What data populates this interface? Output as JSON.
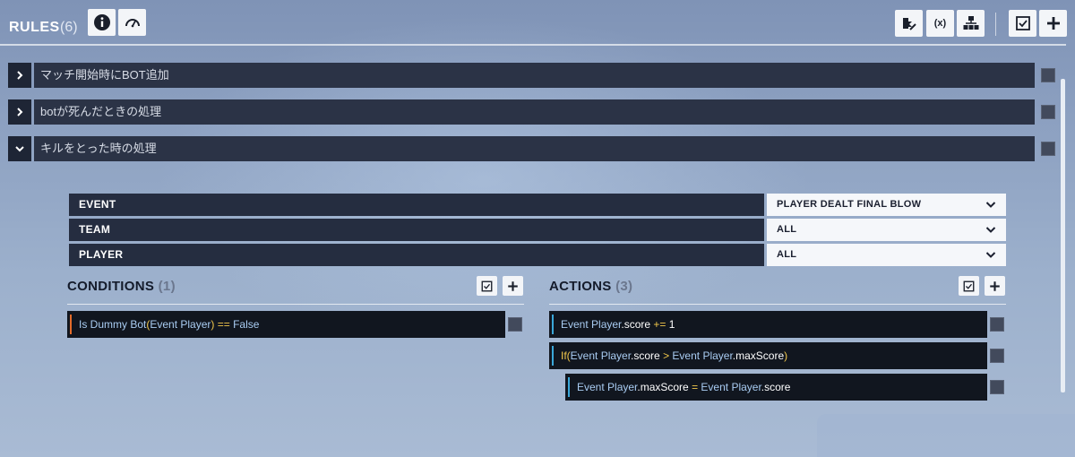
{
  "header": {
    "title": "RULES",
    "count": "(6)",
    "buttons_left": [
      {
        "icon": "info-icon",
        "name": "info-button"
      },
      {
        "icon": "speedometer-icon",
        "name": "performance-button"
      }
    ],
    "buttons_right": [
      {
        "icon": "add-rule-sequence-icon",
        "name": "sequence-button"
      },
      {
        "icon": "variables-icon",
        "name": "variables-button"
      },
      {
        "icon": "subroutines-icon",
        "name": "subroutines-button"
      },
      {
        "icon": "checkbox-icon",
        "name": "select-all-button"
      },
      {
        "icon": "plus-icon",
        "name": "add-rule-button"
      }
    ],
    "variables_glyph": "(x)"
  },
  "rules": [
    {
      "name": "マッチ開始時にBOT追加",
      "expanded": false
    },
    {
      "name": "botが死んだときの処理",
      "expanded": false
    },
    {
      "name": "キルをとった時の処理",
      "expanded": true
    }
  ],
  "event": {
    "rows": [
      {
        "label": "EVENT",
        "value": "PLAYER DEALT FINAL BLOW"
      },
      {
        "label": "TEAM",
        "value": "ALL"
      },
      {
        "label": "PLAYER",
        "value": "ALL"
      }
    ]
  },
  "conditions": {
    "title": "CONDITIONS",
    "count": "(1)",
    "items": [
      {
        "parts": [
          "Is Dummy Bot",
          "(",
          "Event Player",
          ")",
          " == ",
          "False"
        ]
      }
    ]
  },
  "actions": {
    "title": "ACTIONS",
    "count": "(3)",
    "items": [
      {
        "parts": [
          "Event Player",
          ".score",
          " += ",
          "1"
        ],
        "indent": 0
      },
      {
        "parts": [
          "If",
          "(",
          "Event Player",
          ".score",
          " > ",
          "Event Player",
          ".maxScore",
          ")"
        ],
        "indent": 0
      },
      {
        "parts": [
          "Event Player",
          ".maxScore",
          " = ",
          "Event Player",
          ".score"
        ],
        "indent": 1
      }
    ]
  },
  "colors": {
    "condition_accent": "#e36b2a",
    "action_accent": "#3aa7d8",
    "keyword": "#f2c84b",
    "value_blue": "#a9ccf2"
  }
}
